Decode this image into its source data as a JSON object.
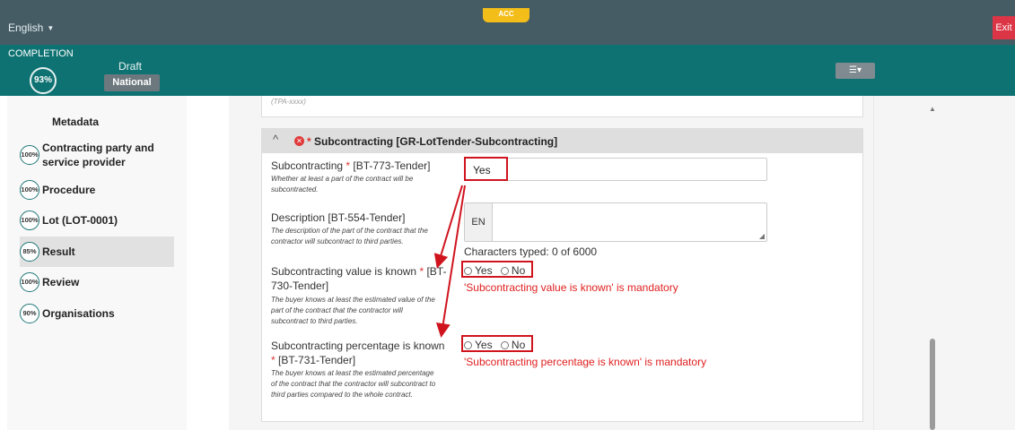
{
  "header": {
    "language": "English",
    "env_badge": "ACC",
    "exit_label": "Exit",
    "completion_label": "COMPLETION",
    "completion_percent": "93%",
    "status": "Draft",
    "scope": "National"
  },
  "sidebar": {
    "metadata_label": "Metadata",
    "items": [
      {
        "percent": "100%",
        "label": "Contracting party and service provider"
      },
      {
        "percent": "100%",
        "label": "Procedure"
      },
      {
        "percent": "100%",
        "label": "Lot (LOT-0001)"
      },
      {
        "percent": "85%",
        "label": "Result"
      },
      {
        "percent": "100%",
        "label": "Review"
      },
      {
        "percent": "90%",
        "label": "Organisations"
      }
    ],
    "active_item": "Result"
  },
  "form": {
    "previous_hint": "(TPA-xxxx)",
    "section": {
      "title": "Subcontracting",
      "code": "[GR-LotTender-Subcontracting]"
    },
    "subcontracting": {
      "label": "Subcontracting",
      "code": "[BT-773-Tender]",
      "help": "Whether at least a part of the contract will be subcontracted.",
      "value": "Yes"
    },
    "description": {
      "label": "Description [BT-554-Tender]",
      "help": "The description of the part of the contract that the contractor will subcontract to third parties.",
      "language": "EN",
      "chars_typed": "Characters typed: 0 of 6000"
    },
    "value_known": {
      "label": "Subcontracting value is known",
      "code": "[BT-730-Tender]",
      "help": "The buyer knows at least the estimated value of the part of the contract that the contractor will subcontract to third parties.",
      "option_yes": "Yes",
      "option_no": "No",
      "error": "'Subcontracting value is known' is mandatory"
    },
    "percentage_known": {
      "label": "Subcontracting percentage is known",
      "code": "[BT-731-Tender]",
      "help": "The buyer knows at least the estimated percentage of the contract that the contractor will subcontract to third parties compared to the whole contract.",
      "option_yes": "Yes",
      "option_no": "No",
      "error": "'Subcontracting percentage is known' is mandatory"
    }
  },
  "colors": {
    "topbar": "#455c65",
    "teal": "#0f7272",
    "annotation_red": "#d0141e",
    "error_text": "#e02020"
  }
}
